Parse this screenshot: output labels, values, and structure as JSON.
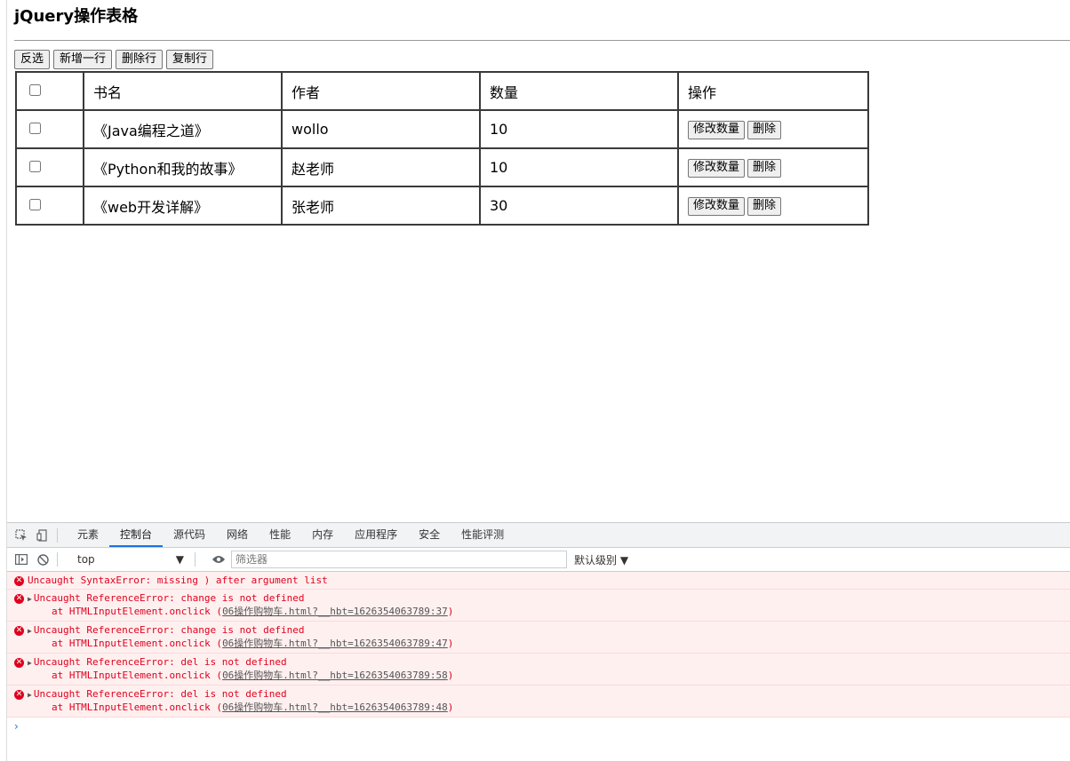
{
  "page": {
    "title": "jQuery操作表格",
    "toolbar": [
      "反选",
      "新增一行",
      "删除行",
      "复制行"
    ],
    "table": {
      "headers": [
        "书名",
        "作者",
        "数量",
        "操作"
      ],
      "rows": [
        {
          "name": "《Java编程之道》",
          "author": "wollo",
          "count": "10"
        },
        {
          "name": "《Python和我的故事》",
          "author": "赵老师",
          "count": "10"
        },
        {
          "name": "《web开发详解》",
          "author": "张老师",
          "count": "30"
        }
      ],
      "action_labels": {
        "edit": "修改数量",
        "delete": "删除"
      }
    }
  },
  "devtools": {
    "tabs": [
      "元素",
      "控制台",
      "源代码",
      "网络",
      "性能",
      "内存",
      "应用程序",
      "安全",
      "性能评测"
    ],
    "active_tab": "控制台",
    "context": "top",
    "filter_placeholder": "筛选器",
    "levels": "默认级别 ▼",
    "logs": [
      {
        "message": "Uncaught SyntaxError: missing ) after argument list",
        "expandable": false,
        "sub": "",
        "link": "",
        "suffix": ""
      },
      {
        "message": "Uncaught ReferenceError: change is not defined",
        "expandable": true,
        "sub": "at HTMLInputElement.onclick (",
        "link": "06操作购物车.html?__hbt=1626354063789:37",
        "suffix": ")"
      },
      {
        "message": "Uncaught ReferenceError: change is not defined",
        "expandable": true,
        "sub": "at HTMLInputElement.onclick (",
        "link": "06操作购物车.html?__hbt=1626354063789:47",
        "suffix": ")"
      },
      {
        "message": "Uncaught ReferenceError: del is not defined",
        "expandable": true,
        "sub": "at HTMLInputElement.onclick (",
        "link": "06操作购物车.html?__hbt=1626354063789:58",
        "suffix": ")"
      },
      {
        "message": "Uncaught ReferenceError: del is not defined",
        "expandable": true,
        "sub": "at HTMLInputElement.onclick (",
        "link": "06操作购物车.html?__hbt=1626354063789:48",
        "suffix": ")"
      }
    ],
    "prompt": "›"
  },
  "colors": {
    "error": "#e0001d",
    "error_bg": "#fff0f0",
    "accent": "#1a73e8"
  }
}
